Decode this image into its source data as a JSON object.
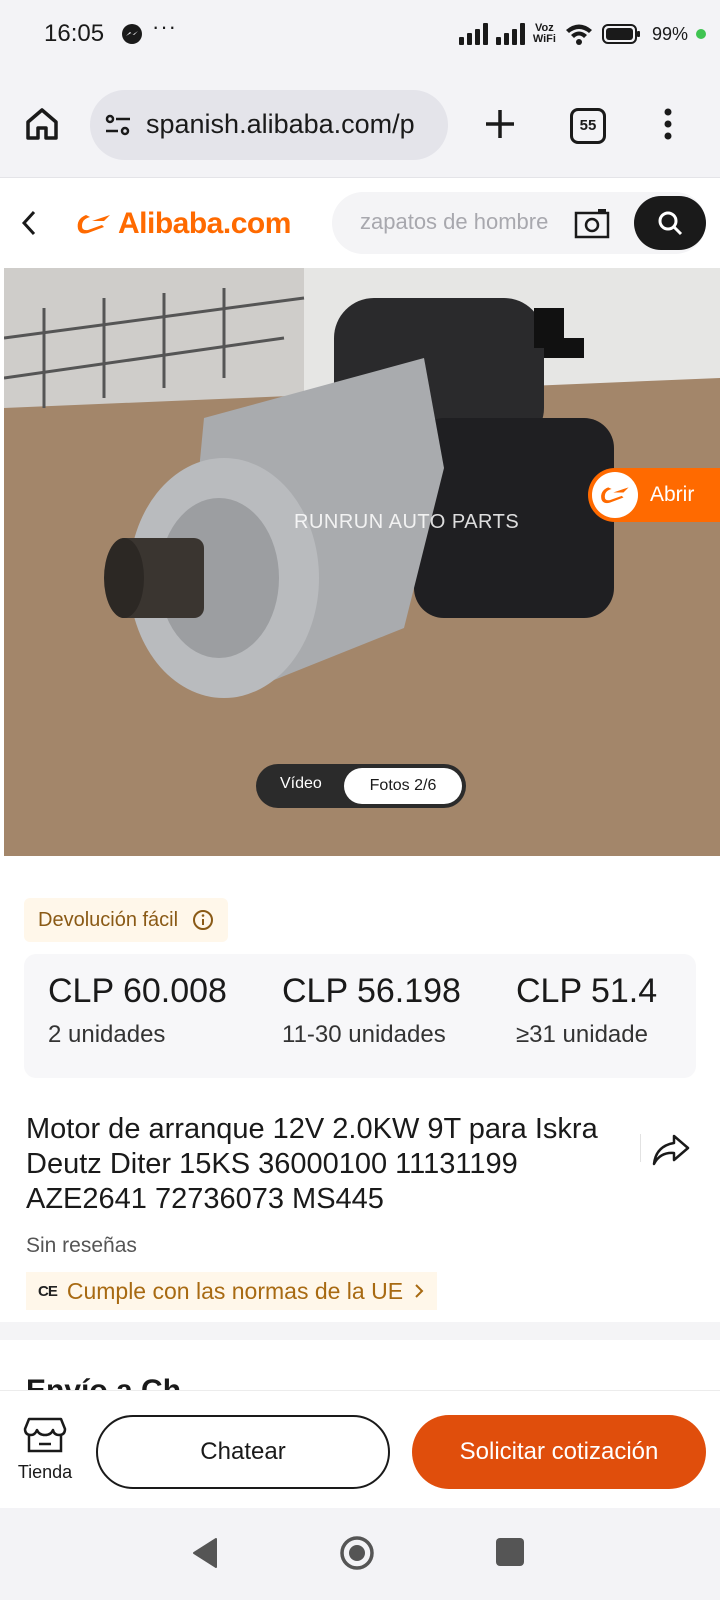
{
  "status_bar": {
    "time": "16:05",
    "dots": "···",
    "voz": "Voz",
    "wifi_label": "WiFi",
    "battery": "99%"
  },
  "browser": {
    "url": "spanish.alibaba.com/p",
    "tab_count": "55"
  },
  "header": {
    "logo_text": "Alibaba.com",
    "search_placeholder": "zapatos de hombre"
  },
  "gallery": {
    "watermark": "RUNRUN AUTO PARTS",
    "open_app_label": "Abrir",
    "video_label": "Vídeo",
    "photos_label": "Fotos 2/6"
  },
  "badges": {
    "easy_return": "Devolución fácil"
  },
  "prices": [
    {
      "value": "CLP 60.008",
      "qty": "2 unidades"
    },
    {
      "value": "CLP 56.198",
      "qty": "11-30 unidades"
    },
    {
      "value": "CLP 51.4",
      "qty": "≥31 unidade"
    }
  ],
  "product": {
    "title": "Motor de arranque 12V 2.0KW 9T para Iskra Deutz Diter 15KS 36000100 11131199 AZE2641 72736073 MS445",
    "reviews": "Sin reseñas",
    "ce_mark": "CE",
    "ce_text": "Cumple con las normas de la UE",
    "next_section_fragment": "Envío a Ch"
  },
  "actions": {
    "store_label": "Tienda",
    "chat_label": "Chatear",
    "quote_label": "Solicitar cotización"
  },
  "colors": {
    "brand_orange": "#ff6a00",
    "quote_button": "#e04e0c",
    "badge_text": "#8a5a16"
  }
}
